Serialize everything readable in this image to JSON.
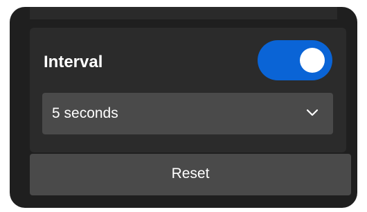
{
  "interval": {
    "label": "Interval",
    "toggle_on": true
  },
  "select": {
    "value": "5 seconds",
    "icon": "chevron-down-icon"
  },
  "reset": {
    "label": "Reset"
  },
  "colors": {
    "panel_bg": "#1f1f1f",
    "section_bg": "#2b2b2b",
    "control_bg": "#4a4a4a",
    "toggle_on": "#0a64d6",
    "text": "#ffffff"
  }
}
